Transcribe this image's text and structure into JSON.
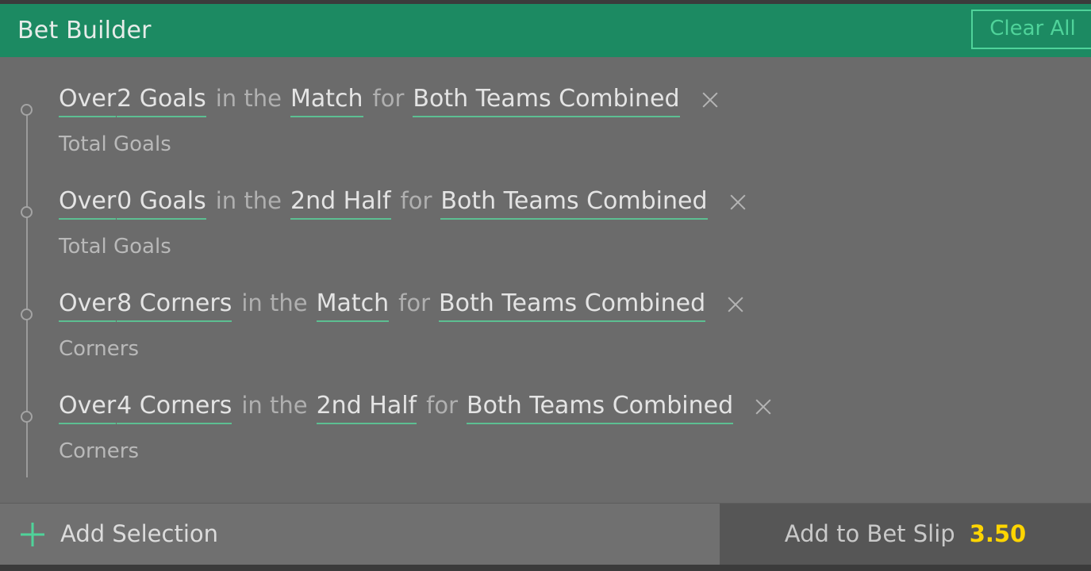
{
  "header": {
    "title": "Bet Builder",
    "clear_all_label": "Clear All",
    "accent_color": "#1c8a62",
    "accent_light": "#4fd39a"
  },
  "selections": [
    {
      "line": "Over 2 Goals in the Match for Both Teams Combined",
      "tokens": [
        "Over",
        "2 Goals"
      ],
      "connector1": "in the",
      "scope": "Match",
      "connector2": "for",
      "subject": "Both Teams Combined",
      "subtitle": "Total Goals",
      "remove_icon": "close-icon"
    },
    {
      "line": "Over 0 Goals in the 2nd Half for Both Teams Combined",
      "tokens": [
        "Over",
        "0 Goals"
      ],
      "connector1": "in the",
      "scope": "2nd Half",
      "connector2": "for",
      "subject": "Both Teams Combined",
      "subtitle": "Total Goals",
      "remove_icon": "close-icon"
    },
    {
      "line": "Over 8 Corners in the Match for Both Teams Combined",
      "tokens": [
        "Over",
        "8 Corners"
      ],
      "connector1": "in the",
      "scope": "Match",
      "connector2": "for",
      "subject": "Both Teams Combined",
      "subtitle": "Corners",
      "remove_icon": "close-icon"
    },
    {
      "line": "Over 4 Corners in the 2nd Half for Both Teams Combined",
      "tokens": [
        "Over",
        "4 Corners"
      ],
      "connector1": "in the",
      "scope": "2nd Half",
      "connector2": "for",
      "subject": "Both Teams Combined",
      "subtitle": "Corners",
      "remove_icon": "close-icon"
    }
  ],
  "footer": {
    "add_selection_label": "Add Selection",
    "add_selection_icon": "plus-icon",
    "bet_slip_label": "Add to Bet Slip",
    "odds": "3.50",
    "odds_color": "#ffd500"
  }
}
